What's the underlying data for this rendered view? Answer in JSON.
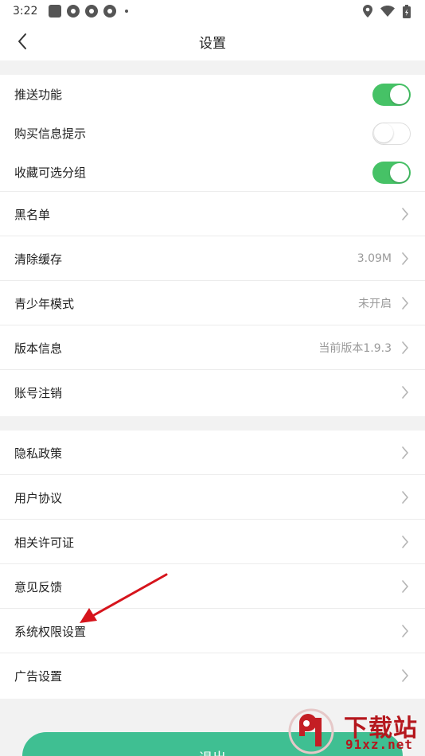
{
  "status_bar": {
    "time": "3:22"
  },
  "nav": {
    "title": "设置"
  },
  "toggles": [
    {
      "label": "推送功能",
      "state": "on"
    },
    {
      "label": "购买信息提示",
      "state": "off"
    },
    {
      "label": "收藏可选分组",
      "state": "on"
    }
  ],
  "group1_rows": [
    {
      "label": "黑名单",
      "value": ""
    },
    {
      "label": "清除缓存",
      "value": "3.09M"
    },
    {
      "label": "青少年模式",
      "value": "未开启"
    },
    {
      "label": "版本信息",
      "value": "当前版本1.9.3"
    },
    {
      "label": "账号注销",
      "value": ""
    }
  ],
  "group2_rows": [
    {
      "label": "隐私政策"
    },
    {
      "label": "用户协议"
    },
    {
      "label": "相关许可证"
    },
    {
      "label": "意见反馈"
    },
    {
      "label": "系统权限设置"
    },
    {
      "label": "广告设置"
    }
  ],
  "logout": {
    "label": "退出"
  },
  "watermark": {
    "brand": "下载站",
    "url": "91xz.net"
  },
  "colors": {
    "accent_green": "#46c266",
    "logout_green": "#3fbf92",
    "annotation_red": "#d6141c"
  }
}
